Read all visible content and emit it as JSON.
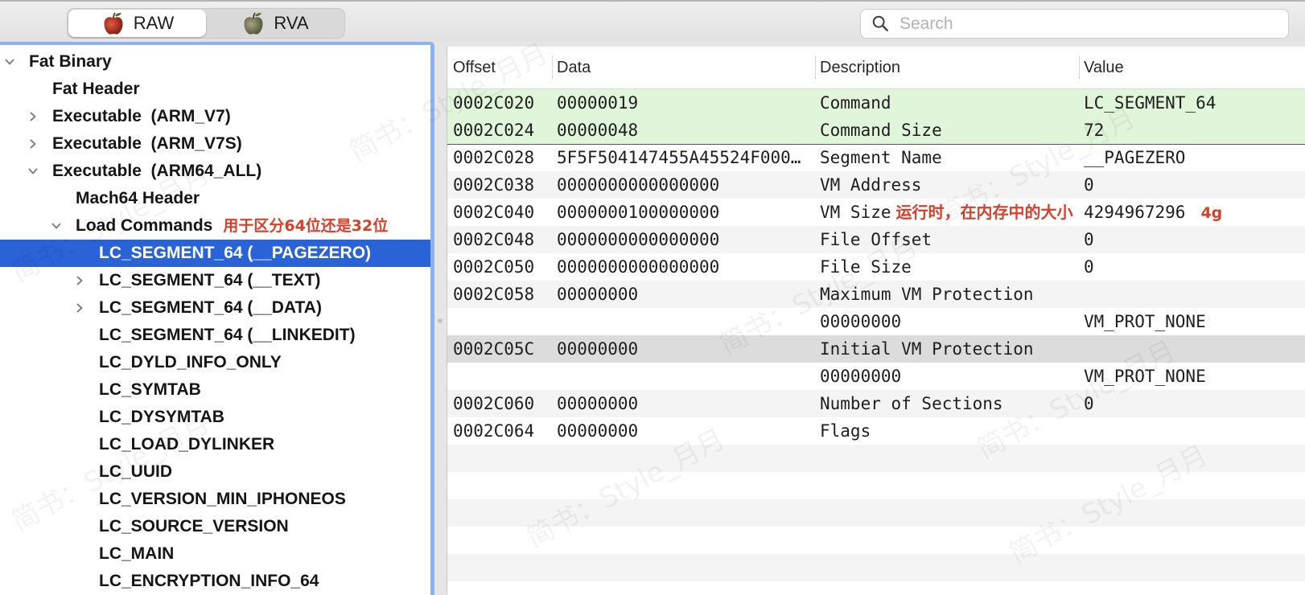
{
  "colors": {
    "selection": "#2a62d8",
    "annotation": "#d6402c",
    "highlight_green": "#e1f5da",
    "row_selected": "#dcdcdc",
    "stripe": "#f4f4f4",
    "focus_ring": "#8cb2ef"
  },
  "toolbar": {
    "view_modes": [
      {
        "label": "RAW",
        "icon": "apple-red-icon",
        "selected": true
      },
      {
        "label": "RVA",
        "icon": "apple-green-icon",
        "selected": false
      }
    ],
    "search": {
      "placeholder": "Search",
      "icon": "search-icon"
    }
  },
  "tree": [
    {
      "label": "Fat Binary",
      "expanded": true,
      "children": [
        {
          "label": "Fat Header"
        },
        {
          "label": "Executable  (ARM_V7)",
          "expandable": true,
          "expanded": false
        },
        {
          "label": "Executable  (ARM_V7S)",
          "expandable": true,
          "expanded": false
        },
        {
          "label": "Executable  (ARM64_ALL)",
          "expanded": true,
          "children": [
            {
              "label": "Mach64 Header"
            },
            {
              "label": "Load Commands",
              "expanded": true,
              "annotation": "用于区分64位还是32位",
              "children": [
                {
                  "label": "LC_SEGMENT_64 (__PAGEZERO)",
                  "selected": true
                },
                {
                  "label": "LC_SEGMENT_64 (__TEXT)",
                  "expandable": true,
                  "expanded": false
                },
                {
                  "label": "LC_SEGMENT_64 (__DATA)",
                  "expandable": true,
                  "expanded": false
                },
                {
                  "label": "LC_SEGMENT_64 (__LINKEDIT)"
                },
                {
                  "label": "LC_DYLD_INFO_ONLY"
                },
                {
                  "label": "LC_SYMTAB"
                },
                {
                  "label": "LC_DYSYMTAB"
                },
                {
                  "label": "LC_LOAD_DYLINKER"
                },
                {
                  "label": "LC_UUID"
                },
                {
                  "label": "LC_VERSION_MIN_IPHONEOS"
                },
                {
                  "label": "LC_SOURCE_VERSION"
                },
                {
                  "label": "LC_MAIN"
                },
                {
                  "label": "LC_ENCRYPTION_INFO_64"
                }
              ]
            }
          ]
        }
      ]
    }
  ],
  "table": {
    "columns": [
      "Offset",
      "Data",
      "Description",
      "Value"
    ],
    "rows": [
      {
        "offset": "0002C020",
        "data": "00000019",
        "description": "Command",
        "value": "LC_SEGMENT_64",
        "highlight": "green"
      },
      {
        "offset": "0002C024",
        "data": "00000048",
        "description": "Command Size",
        "value": "72",
        "highlight": "green"
      },
      {
        "offset": "0002C028",
        "data": "5F5F504147455A45524F000…",
        "description": "Segment Name",
        "value": "__PAGEZERO"
      },
      {
        "offset": "0002C038",
        "data": "0000000000000000",
        "description": "VM Address",
        "value": "0"
      },
      {
        "offset": "0002C040",
        "data": "0000000100000000",
        "description": "VM Size",
        "description_note": "运行时，在内存中的大小",
        "value": "4294967296",
        "value_note": "4g"
      },
      {
        "offset": "0002C048",
        "data": "0000000000000000",
        "description": "File Offset",
        "value": "0"
      },
      {
        "offset": "0002C050",
        "data": "0000000000000000",
        "description": "File Size",
        "value": "0"
      },
      {
        "offset": "0002C058",
        "data": "00000000",
        "description": "Maximum VM Protection"
      },
      {
        "description": "00000000",
        "value": "VM_PROT_NONE"
      },
      {
        "offset": "0002C05C",
        "data": "00000000",
        "description": "Initial VM Protection",
        "selected": true
      },
      {
        "description": "00000000",
        "value": "VM_PROT_NONE"
      },
      {
        "offset": "0002C060",
        "data": "00000000",
        "description": "Number of Sections",
        "value": "0"
      },
      {
        "offset": "0002C064",
        "data": "00000000",
        "description": "Flags"
      }
    ]
  },
  "watermark": "简书：Style_月月"
}
